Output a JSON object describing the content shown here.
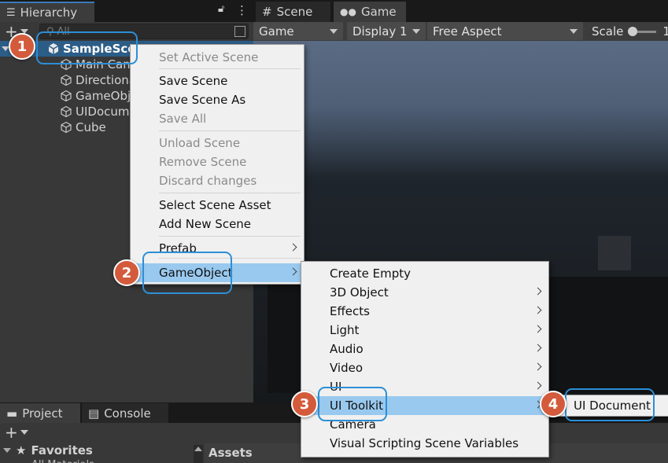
{
  "hierarchy": {
    "tab_label": "Hierarchy",
    "search_placeholder": "All",
    "scene_name": "SampleScene",
    "scene_label_visible": "SampleSce",
    "items": [
      "Main Cam",
      "Directional",
      "GameObje",
      "UIDocum",
      "Cube"
    ]
  },
  "scene_tabs": {
    "scene": "Scene",
    "game": "Game"
  },
  "game_toolbar": {
    "display_mode": "Game",
    "display": "Display 1",
    "aspect": "Free Aspect",
    "scale_label": "Scale",
    "scale_value": "1"
  },
  "bottom": {
    "project_tab": "Project",
    "console_tab": "Console",
    "favorites": "Favorites",
    "favorites_child": "All Materials",
    "assets": "Assets"
  },
  "context_menu": {
    "items": [
      {
        "label": "Set Active Scene",
        "enabled": false
      },
      {
        "label": "Save Scene",
        "enabled": true
      },
      {
        "label": "Save Scene As",
        "enabled": true
      },
      {
        "label": "Save All",
        "enabled": false
      },
      {
        "label": "Unload Scene",
        "enabled": false
      },
      {
        "label": "Remove Scene",
        "enabled": false
      },
      {
        "label": "Discard changes",
        "enabled": false
      },
      {
        "label": "Select Scene Asset",
        "enabled": true
      },
      {
        "label": "Add New Scene",
        "enabled": true
      },
      {
        "label": "Prefab",
        "enabled": true,
        "submenu": true
      },
      {
        "label": "GameObject",
        "enabled": true,
        "submenu": true,
        "highlighted": true
      }
    ]
  },
  "gameobject_menu": {
    "items": [
      {
        "label": "Create Empty",
        "submenu": false
      },
      {
        "label": "3D Object",
        "submenu": true
      },
      {
        "label": "Effects",
        "submenu": true
      },
      {
        "label": "Light",
        "submenu": true
      },
      {
        "label": "Audio",
        "submenu": true
      },
      {
        "label": "Video",
        "submenu": true
      },
      {
        "label": "UI",
        "submenu": true
      },
      {
        "label": "UI Toolkit",
        "submenu": true,
        "highlighted": true
      },
      {
        "label": "Camera",
        "submenu": false
      },
      {
        "label": "Visual Scripting Scene Variables",
        "submenu": false
      }
    ]
  },
  "uitoolkit_menu": {
    "items": [
      {
        "label": "UI Document"
      }
    ]
  },
  "steps": [
    "1",
    "2",
    "3",
    "4"
  ],
  "colors": {
    "highlight": "#99c9ef",
    "badge": "#d35b3b",
    "callout": "#2c8fd6",
    "selection": "#2c5d87"
  }
}
